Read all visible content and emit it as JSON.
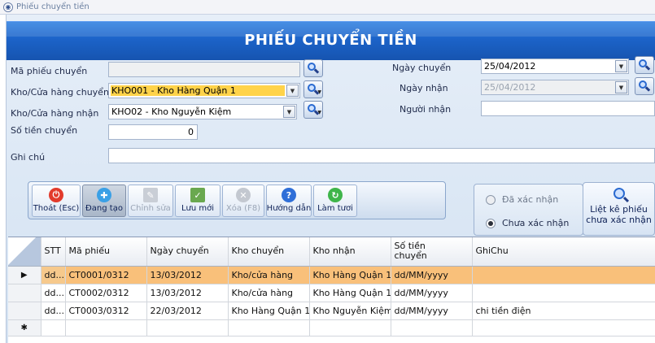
{
  "window": {
    "title": "Phiếu chuyển tiền"
  },
  "banner": {
    "title": "PHIẾU CHUYỂN TIỀN"
  },
  "form": {
    "ma_phieu": {
      "label": "Mã phiếu chuyển",
      "value": ""
    },
    "kho_chuyen": {
      "label": "Kho/Cửa hàng chuyển",
      "value": "KHO001 - Kho Hàng Quận 1"
    },
    "kho_nhan": {
      "label": "Kho/Cửa hàng nhận",
      "value": "KHO02 - Kho Nguyễn Kiệm"
    },
    "so_tien": {
      "label": "Số tiền chuyển",
      "value": "0"
    },
    "ghi_chu": {
      "label": "Ghi chú",
      "value": ""
    },
    "ngay_chuyen": {
      "label": "Ngày chuyển",
      "value": "25/04/2012"
    },
    "ngay_nhan": {
      "label": "Ngày nhận",
      "value": "25/04/2012"
    },
    "nguoi_nhan": {
      "label": "Người nhận",
      "value": ""
    }
  },
  "toolbar": {
    "exit": "Thoát (Esc)",
    "creating": "Đang tạo",
    "edit": "Chỉnh sửa",
    "save_new": "Lưu mới",
    "delete": "Xóa (F8)",
    "help": "Hướng dẫn",
    "refresh": "Làm tươi"
  },
  "status_filter": {
    "confirmed": "Đã xác nhận",
    "unconfirmed": "Chưa xác nhận",
    "selected": "unconfirmed"
  },
  "list_button": {
    "line1": "Liệt kê phiếu",
    "line2": "chưa xác nhận"
  },
  "grid": {
    "columns": {
      "stt": "STT",
      "ma_phieu": "Mã phiếu",
      "ngay_chuyen": "Ngày chuyển",
      "kho_chuyen": "Kho chuyển",
      "kho_nhan": "Kho nhận",
      "so_tien_1": "Số tiền",
      "so_tien_2": "chuyển",
      "ghichu": "GhiChu"
    },
    "rows": [
      {
        "stt": "dd...",
        "ma_phieu": "CT0001/0312",
        "ngay_chuyen": "13/03/2012",
        "kho_chuyen": "Kho/cửa hàng",
        "kho_nhan": "Kho Hàng Quận 1",
        "so_tien": "dd/MM/yyyy",
        "ghichu": ""
      },
      {
        "stt": "dd...",
        "ma_phieu": "CT0002/0312",
        "ngay_chuyen": "13/03/2012",
        "kho_chuyen": "Kho/cửa hàng",
        "kho_nhan": "Kho Hàng Quận 1",
        "so_tien": "dd/MM/yyyy",
        "ghichu": ""
      },
      {
        "stt": "dd...",
        "ma_phieu": "CT0003/0312",
        "ngay_chuyen": "22/03/2012",
        "kho_chuyen": "Kho Hàng Quận 1",
        "kho_nhan": "Kho Nguyễn Kiệm",
        "so_tien": "dd/MM/yyyy",
        "ghichu": "chi tiền điện"
      }
    ],
    "current_row_marker": "▶",
    "new_row_marker": "✱"
  },
  "colors": {
    "banner": "#1c63c8",
    "selected_row": "#f9c07a",
    "highlight_value": "#ffd34a"
  }
}
